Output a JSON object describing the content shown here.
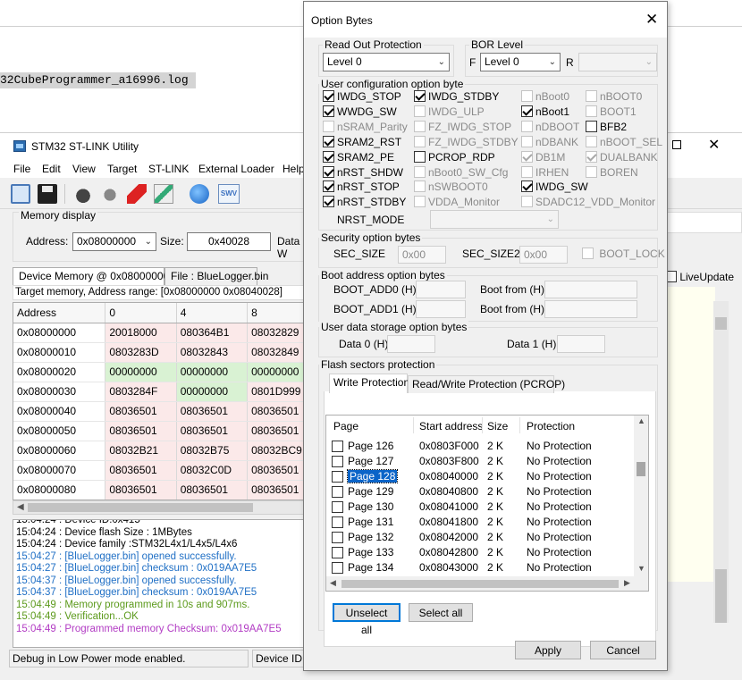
{
  "background": {
    "log_file_text": "32CubeProgrammer_a16996.log"
  },
  "stlink": {
    "title": "STM32 ST-LINK Utility",
    "menu": [
      "File",
      "Edit",
      "View",
      "Target",
      "ST-LINK",
      "External Loader",
      "Help"
    ],
    "toolbar": {
      "swv_label": "SWV"
    },
    "memory_display": {
      "legend": "Memory display",
      "address_label": "Address:",
      "address_value": "0x08000000",
      "size_label": "Size:",
      "size_value": "0x40028",
      "data_width_label": "Data W"
    },
    "tabs": [
      "Device Memory @ 0x08000000 :",
      "File : BlueLogger.bin"
    ],
    "address_range": "Target memory, Address range: [0x08000000 0x08040028]",
    "table": {
      "headers": [
        "Address",
        "0",
        "4",
        "8"
      ],
      "rows": [
        {
          "addr": "0x08000000",
          "c0": "20018000",
          "c1": "080364B1",
          "c2": "08032829",
          "green": []
        },
        {
          "addr": "0x08000010",
          "c0": "0803283D",
          "c1": "08032843",
          "c2": "08032849",
          "green": []
        },
        {
          "addr": "0x08000020",
          "c0": "00000000",
          "c1": "00000000",
          "c2": "00000000",
          "green": [
            0,
            1,
            2
          ]
        },
        {
          "addr": "0x08000030",
          "c0": "0803284F",
          "c1": "00000000",
          "c2": "0801D999",
          "green": [
            1
          ]
        },
        {
          "addr": "0x08000040",
          "c0": "08036501",
          "c1": "08036501",
          "c2": "08036501",
          "green": []
        },
        {
          "addr": "0x08000050",
          "c0": "08036501",
          "c1": "08036501",
          "c2": "08036501",
          "green": []
        },
        {
          "addr": "0x08000060",
          "c0": "08032B21",
          "c1": "08032B75",
          "c2": "08032BC9",
          "green": []
        },
        {
          "addr": "0x08000070",
          "c0": "08036501",
          "c1": "08032C0D",
          "c2": "08036501",
          "green": []
        },
        {
          "addr": "0x08000080",
          "c0": "08036501",
          "c1": "08036501",
          "c2": "08036501",
          "green": []
        }
      ]
    },
    "log": [
      {
        "text": "15:04:24 : Device ID:0x415",
        "color": "black"
      },
      {
        "text": "15:04:24 : Device flash Size : 1MBytes",
        "color": "black"
      },
      {
        "text": "15:04:24 : Device family :STM32L4x1/L4x5/L4x6",
        "color": "black"
      },
      {
        "text": "15:04:27 : [BlueLogger.bin] opened successfully.",
        "color": "blue"
      },
      {
        "text": "15:04:27 : [BlueLogger.bin] checksum : 0x019AA7E5",
        "color": "blue"
      },
      {
        "text": "15:04:37 : [BlueLogger.bin] opened successfully.",
        "color": "blue"
      },
      {
        "text": "15:04:37 : [BlueLogger.bin] checksum : 0x019AA7E5",
        "color": "blue"
      },
      {
        "text": "15:04:49 : Memory programmed in 10s and 907ms.",
        "color": "green"
      },
      {
        "text": "15:04:49 : Verification...OK",
        "color": "green"
      },
      {
        "text": "15:04:49 : Programmed memory Checksum: 0x019AA7E5",
        "color": "purple"
      }
    ],
    "status_left": "Debug in Low Power mode enabled.",
    "status_mid": "Device ID:0",
    "live_update_label": "LiveUpdate"
  },
  "dialog": {
    "title": "Option Bytes",
    "read_out": {
      "legend": "Read Out Protection",
      "value": "Level 0"
    },
    "bor": {
      "legend": "BOR Level",
      "f_label": "F",
      "f_value": "Level 0",
      "r_label": "R",
      "r_value": ""
    },
    "user_config": {
      "legend": "User configuration option byte",
      "options": [
        {
          "label": "IWDG_STOP",
          "checked": true,
          "enabled": true
        },
        {
          "label": "IWDG_STDBY",
          "checked": true,
          "enabled": true
        },
        {
          "label": "nBoot0",
          "checked": false,
          "enabled": false
        },
        {
          "label": "nBOOT0",
          "checked": false,
          "enabled": false
        },
        {
          "label": "WWDG_SW",
          "checked": true,
          "enabled": true
        },
        {
          "label": "IWDG_ULP",
          "checked": false,
          "enabled": false
        },
        {
          "label": "nBoot1",
          "checked": true,
          "enabled": true
        },
        {
          "label": "BOOT1",
          "checked": false,
          "enabled": false
        },
        {
          "label": "nSRAM_Parity",
          "checked": false,
          "enabled": false
        },
        {
          "label": "FZ_IWDG_STOP",
          "checked": false,
          "enabled": false
        },
        {
          "label": "nDBOOT",
          "checked": false,
          "enabled": false
        },
        {
          "label": "BFB2",
          "checked": false,
          "enabled": true
        },
        {
          "label": "SRAM2_RST",
          "checked": true,
          "enabled": true
        },
        {
          "label": "FZ_IWDG_STDBY",
          "checked": false,
          "enabled": false
        },
        {
          "label": "nDBANK",
          "checked": false,
          "enabled": false
        },
        {
          "label": "nBOOT_SEL",
          "checked": false,
          "enabled": false
        },
        {
          "label": "SRAM2_PE",
          "checked": true,
          "enabled": true
        },
        {
          "label": "PCROP_RDP",
          "checked": false,
          "enabled": true
        },
        {
          "label": "DB1M",
          "checked": true,
          "enabled": false
        },
        {
          "label": "DUALBANK",
          "checked": true,
          "enabled": false
        },
        {
          "label": "nRST_SHDW",
          "checked": true,
          "enabled": true
        },
        {
          "label": "nBoot0_SW_Cfg",
          "checked": false,
          "enabled": false
        },
        {
          "label": "IRHEN",
          "checked": false,
          "enabled": false
        },
        {
          "label": "BOREN",
          "checked": false,
          "enabled": false
        },
        {
          "label": "nRST_STOP",
          "checked": true,
          "enabled": true
        },
        {
          "label": "nSWBOOT0",
          "checked": false,
          "enabled": false
        },
        {
          "label": "IWDG_SW",
          "checked": true,
          "enabled": true
        },
        {
          "label": "nRST_STDBY",
          "checked": true,
          "enabled": true
        },
        {
          "label": "VDDA_Monitor",
          "checked": false,
          "enabled": false
        },
        {
          "label": "SDADC12_VDD_Monitor",
          "checked": false,
          "enabled": false
        }
      ],
      "nrst_mode_label": "NRST_MODE",
      "nrst_mode_value": ""
    },
    "security": {
      "legend": "Security option bytes",
      "sec_size_label": "SEC_SIZE",
      "sec_size_value": "0x00",
      "sec_size2_label": "SEC_SIZE2",
      "sec_size2_value": "0x00",
      "boot_lock_label": "BOOT_LOCK"
    },
    "boot_address": {
      "legend": "Boot address option bytes",
      "add0_label": "BOOT_ADD0 (H)",
      "add1_label": "BOOT_ADD1 (H)",
      "boot_from_label": "Boot from (H)"
    },
    "user_data": {
      "legend": "User data storage option bytes",
      "data0_label": "Data 0 (H)",
      "data1_label": "Data 1 (H)"
    },
    "flash_sectors": {
      "legend": "Flash sectors protection",
      "tabs": [
        "Write Protection",
        "Read/Write Protection (PCROP)"
      ],
      "columns": [
        "Page",
        "Start address",
        "Size",
        "Protection"
      ],
      "pages": [
        {
          "page": "Page 126",
          "addr": "0x0803F000",
          "size": "2 K",
          "prot": "No Protection"
        },
        {
          "page": "Page 127",
          "addr": "0x0803F800",
          "size": "2 K",
          "prot": "No Protection"
        },
        {
          "page": "Page 128",
          "addr": "0x08040000",
          "size": "2 K",
          "prot": "No Protection",
          "selected": true
        },
        {
          "page": "Page 129",
          "addr": "0x08040800",
          "size": "2 K",
          "prot": "No Protection"
        },
        {
          "page": "Page 130",
          "addr": "0x08041000",
          "size": "2 K",
          "prot": "No Protection"
        },
        {
          "page": "Page 131",
          "addr": "0x08041800",
          "size": "2 K",
          "prot": "No Protection"
        },
        {
          "page": "Page 132",
          "addr": "0x08042000",
          "size": "2 K",
          "prot": "No Protection"
        },
        {
          "page": "Page 133",
          "addr": "0x08042800",
          "size": "2 K",
          "prot": "No Protection"
        },
        {
          "page": "Page 134",
          "addr": "0x08043000",
          "size": "2 K",
          "prot": "No Protection"
        }
      ],
      "unselect_all": "Unselect all",
      "select_all": "Select all"
    },
    "apply": "Apply",
    "cancel": "Cancel"
  }
}
